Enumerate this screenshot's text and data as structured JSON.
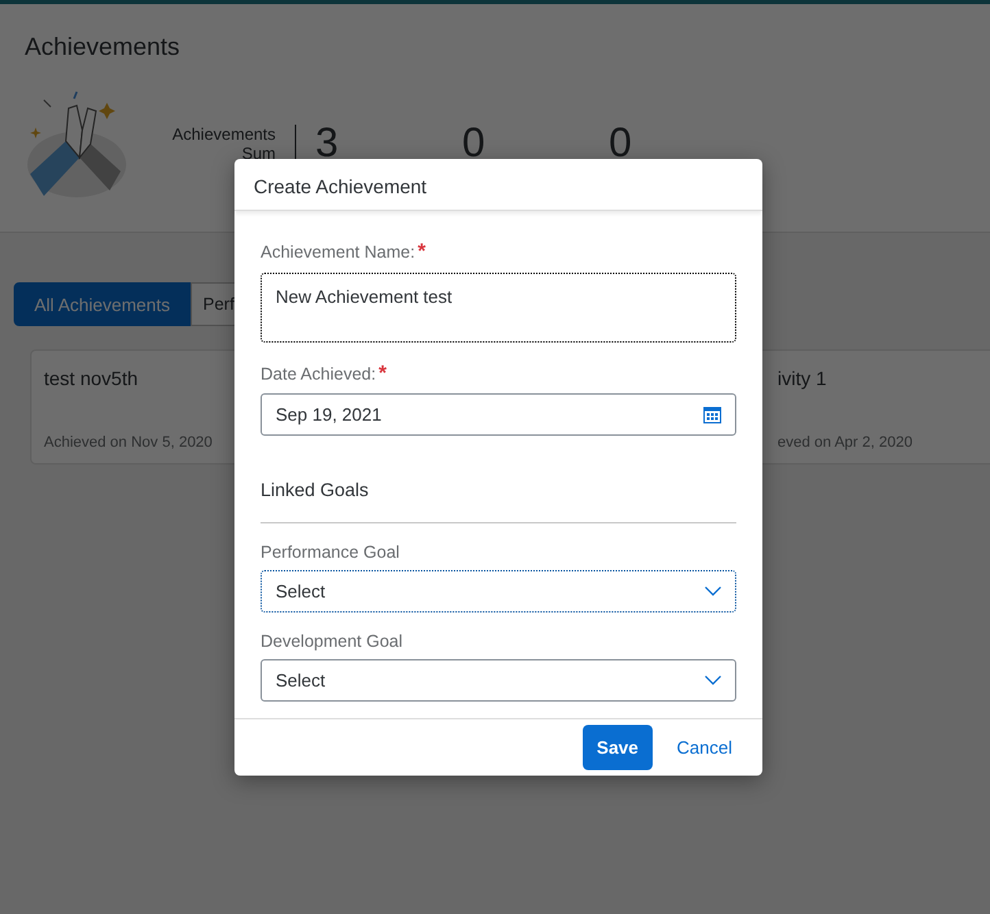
{
  "page": {
    "title": "Achievements",
    "summary": {
      "label_lines": [
        "Achievements",
        "Sum"
      ],
      "counts": [
        "3",
        "0",
        "0"
      ]
    },
    "tabs": [
      {
        "label": "All Achievements",
        "selected": true
      },
      {
        "label": "Perf",
        "selected": false
      }
    ],
    "cards": [
      {
        "title": "test nov5th",
        "subtitle": "Achieved on Nov 5, 2020"
      },
      {
        "title": "ivity 1",
        "subtitle": "eved on Apr 2, 2020"
      }
    ]
  },
  "dialog": {
    "title": "Create Achievement",
    "fields": [
      {
        "kind": "textarea",
        "label": "Achievement Name:",
        "required_mark": "*",
        "value": "New Achievement test",
        "focused": true
      },
      {
        "kind": "date",
        "label": "Date Achieved:",
        "required_mark": "*",
        "value": "Sep 19, 2021",
        "focused": false
      }
    ],
    "section_title": "Linked Goals",
    "selects": [
      {
        "label": "Performance Goal",
        "placeholder": "Select",
        "focused": true
      },
      {
        "label": "Development Goal",
        "placeholder": "Select",
        "focused": false
      }
    ],
    "buttons": [
      {
        "label": "Save",
        "kind": "primary"
      },
      {
        "label": "Cancel",
        "kind": "link"
      }
    ]
  }
}
